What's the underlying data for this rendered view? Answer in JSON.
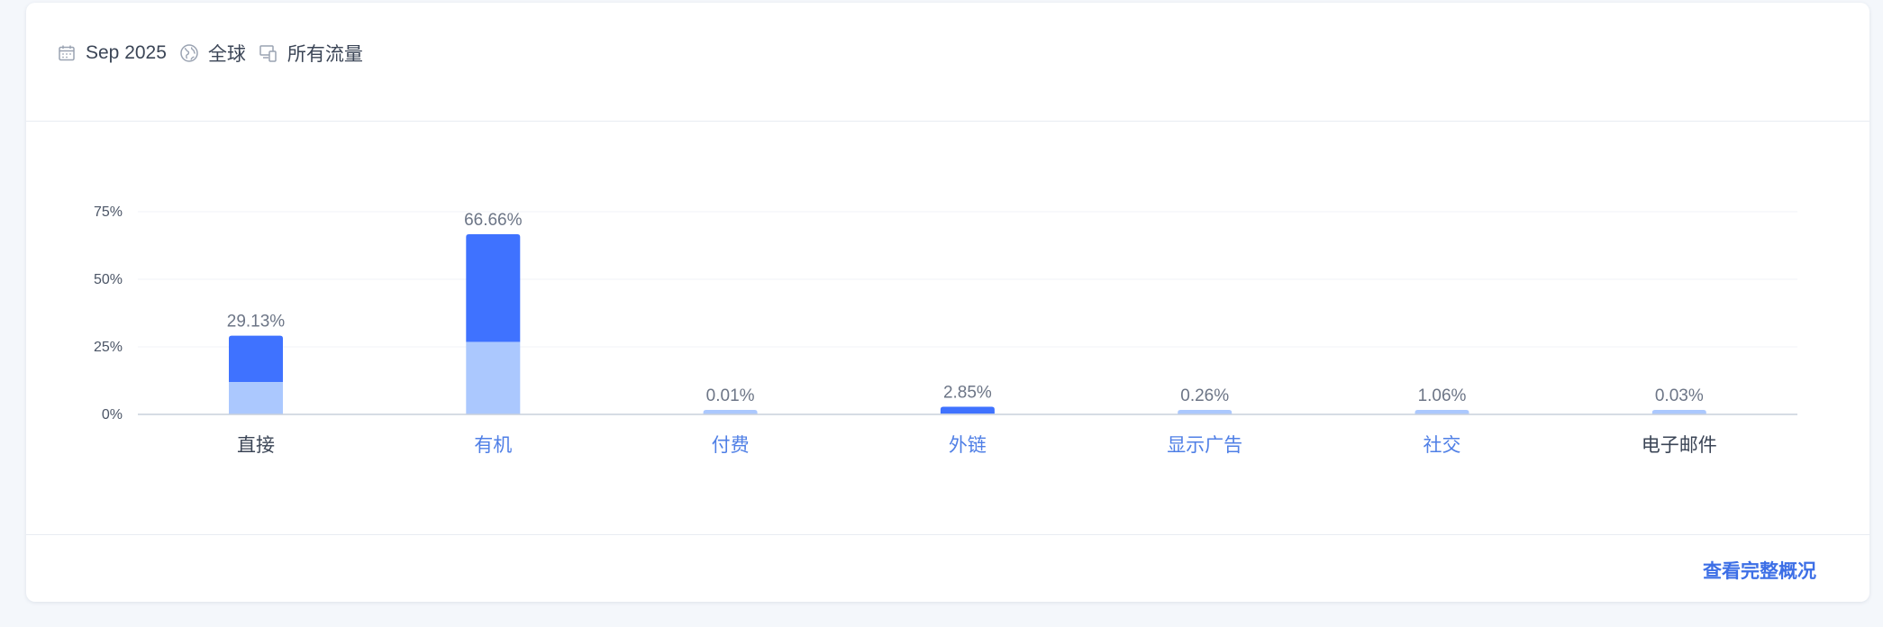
{
  "filters": {
    "date": "Sep 2025",
    "region": "全球",
    "traffic": "所有流量",
    "icons": [
      "calendar-icon",
      "globe-icon",
      "devices-icon"
    ]
  },
  "footer": {
    "link_label": "查看完整概况"
  },
  "colors": {
    "dark_segment": "#3f72ff",
    "light_segment": "#abc8fe",
    "link_label": "#4f7fe6",
    "plain_label": "#3b4556",
    "value_label": "#6c7586",
    "axis": "#c9d0dc",
    "grid": "#f1f3f7"
  },
  "chart_data": {
    "type": "bar",
    "stacked": true,
    "categories": [
      "直接",
      "有机",
      "付费",
      "外链",
      "显示广告",
      "社交",
      "电子邮件"
    ],
    "category_is_link": [
      false,
      true,
      true,
      true,
      true,
      true,
      false
    ],
    "totals": [
      29.13,
      66.66,
      0.01,
      2.85,
      0.26,
      1.06,
      0.03
    ],
    "value_labels": [
      "29.13%",
      "66.66%",
      "0.01%",
      "2.85%",
      "0.26%",
      "1.06%",
      "0.03%"
    ],
    "series": [
      {
        "values": [
          12.0,
          26.8,
          0.01,
          0.3,
          0.26,
          1.06,
          0.03
        ]
      },
      {
        "values": [
          17.13,
          39.86,
          0.0,
          2.55,
          0.0,
          0.0,
          0.0
        ]
      }
    ],
    "yticks": [
      "0%",
      "25%",
      "50%",
      "75%"
    ],
    "ytick_values": [
      0,
      25,
      50,
      75
    ],
    "ylim": [
      0,
      75
    ],
    "grid": true,
    "legend": "none"
  }
}
